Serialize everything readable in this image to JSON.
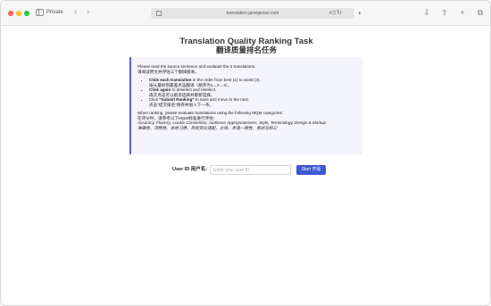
{
  "browser": {
    "profile_label": "Private",
    "url": "translation.georgeoss.com",
    "translate_badge": "A文",
    "icons": {
      "back": "chevron-left-icon",
      "forward": "chevron-right-icon",
      "sidebar": "sidebar-icon",
      "reload": "reload-icon",
      "shield": "shield-icon",
      "download": "download-icon",
      "share": "share-icon",
      "new_tab": "plus-icon",
      "tabs": "tabs-overview-icon"
    }
  },
  "page": {
    "title": "Translation Quality Ranking Task",
    "subtitle": "翻译质量排名任务",
    "instructions": {
      "intro_en": "Please read the source sentence and evaluate the 3 translations.",
      "intro_zh": "请阅读原文并评估三个翻译版本。",
      "bullets": [
        {
          "bold": "Click each translation",
          "rest": " in the order from best (1) to worst (3).",
          "zh": "按从最好到最差点击翻译（顺序为1→2→3）。"
        },
        {
          "bold": "Click again",
          "rest": " to deselect and reselect.",
          "zh": "再次点击可以取消选择并重新选择。"
        },
        {
          "bold": "",
          "rest_prefix": "Click ",
          "bold2": "\"Submit Ranking\"",
          "rest": " to save and move to the next.",
          "zh": "点击\"提交排名\"保存并进入下一条。"
        }
      ],
      "mqm_en": "When ranking, please evaluate translations using the following MQM categories:",
      "mqm_zh": "在评分时，请参考以下MQM标准进行评估：",
      "categories_en": "Accuracy, Fluency, Locale Convention, Audience Appropriateness, Style, Terminology, Design & Markup",
      "categories_zh": "准确性、流畅性、本地习惯、目标受众适配、文体、术语一致性、格式与标记"
    },
    "start": {
      "label": "User ID 用户名:",
      "placeholder": "Enter your user ID",
      "value": "",
      "button": "Start 开始"
    }
  },
  "colors": {
    "accent": "#3f57d6",
    "instruction_border": "#5b5fc7",
    "instruction_bg": "#f4f4fb"
  }
}
